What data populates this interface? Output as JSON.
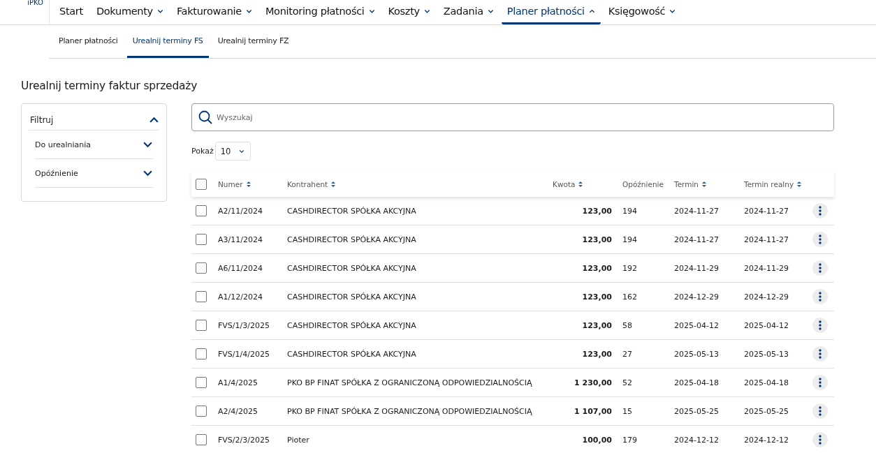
{
  "logo": "iPKO",
  "nav": [
    {
      "label": "Start",
      "dropdown": false,
      "selected": false
    },
    {
      "label": "Dokumenty",
      "dropdown": true,
      "expanded": false,
      "selected": false
    },
    {
      "label": "Fakturowanie",
      "dropdown": true,
      "expanded": false,
      "selected": false
    },
    {
      "label": "Monitoring płatności",
      "dropdown": true,
      "expanded": false,
      "selected": false
    },
    {
      "label": "Koszty",
      "dropdown": true,
      "expanded": false,
      "selected": false
    },
    {
      "label": "Zadania",
      "dropdown": true,
      "expanded": false,
      "selected": false
    },
    {
      "label": "Planer płatności",
      "dropdown": true,
      "expanded": true,
      "selected": true
    },
    {
      "label": "Księgowość",
      "dropdown": true,
      "expanded": false,
      "selected": false
    }
  ],
  "subtabs": [
    {
      "label": "Planer płatności",
      "selected": false
    },
    {
      "label": "Urealnij terminy FS",
      "selected": true
    },
    {
      "label": "Urealnij terminy FZ",
      "selected": false
    }
  ],
  "page_title": "Urealnij terminy faktur sprzedaży",
  "filter": {
    "title": "Filtruj",
    "expanded": true,
    "items": [
      {
        "label": "Do urealniania",
        "expanded": false
      },
      {
        "label": "Opóźnienie",
        "expanded": false
      }
    ]
  },
  "search": {
    "placeholder": "Wyszukaj"
  },
  "page_size": {
    "label": "Pokaż",
    "value": "10"
  },
  "table": {
    "header_checked": false,
    "columns": [
      {
        "label": "Numer",
        "sortable": true
      },
      {
        "label": "Kontrahent",
        "sortable": true
      },
      {
        "label": "Kwota",
        "sortable": true
      },
      {
        "label": "Opóźnienie",
        "sortable": false
      },
      {
        "label": "Termin",
        "sortable": true
      },
      {
        "label": "Termin realny",
        "sortable": true
      }
    ],
    "rows": [
      {
        "selected": false,
        "cells": [
          "A2/11/2024",
          "CASHDIRECTOR SPÓŁKA AKCYJNA",
          "123,00",
          "194",
          "2024-11-27",
          "2024-11-27"
        ]
      },
      {
        "selected": false,
        "cells": [
          "A3/11/2024",
          "CASHDIRECTOR SPÓŁKA AKCYJNA",
          "123,00",
          "194",
          "2024-11-27",
          "2024-11-27"
        ]
      },
      {
        "selected": false,
        "cells": [
          "A6/11/2024",
          "CASHDIRECTOR SPÓŁKA AKCYJNA",
          "123,00",
          "192",
          "2024-11-29",
          "2024-11-29"
        ]
      },
      {
        "selected": false,
        "cells": [
          "A1/12/2024",
          "CASHDIRECTOR SPÓŁKA AKCYJNA",
          "123,00",
          "162",
          "2024-12-29",
          "2024-12-29"
        ]
      },
      {
        "selected": false,
        "cells": [
          "FVS/1/3/2025",
          "CASHDIRECTOR SPÓŁKA AKCYJNA",
          "123,00",
          "58",
          "2025-04-12",
          "2025-04-12"
        ]
      },
      {
        "selected": false,
        "cells": [
          "FVS/1/4/2025",
          "CASHDIRECTOR SPÓŁKA AKCYJNA",
          "123,00",
          "27",
          "2025-05-13",
          "2025-05-13"
        ]
      },
      {
        "selected": false,
        "cells": [
          "A1/4/2025",
          "PKO BP FINAT SPÓŁKA Z OGRANICZONĄ ODPOWIEDZIALNOŚCIĄ",
          "1 230,00",
          "52",
          "2025-04-18",
          "2025-04-18"
        ]
      },
      {
        "selected": false,
        "cells": [
          "A2/4/2025",
          "PKO BP FINAT SPÓŁKA Z OGRANICZONĄ ODPOWIEDZIALNOŚCIĄ",
          "1 107,00",
          "15",
          "2025-05-25",
          "2025-05-25"
        ]
      },
      {
        "selected": false,
        "cells": [
          "FVS/2/3/2025",
          "Pioter",
          "100,00",
          "179",
          "2024-12-12",
          "2024-12-12"
        ]
      }
    ]
  }
}
